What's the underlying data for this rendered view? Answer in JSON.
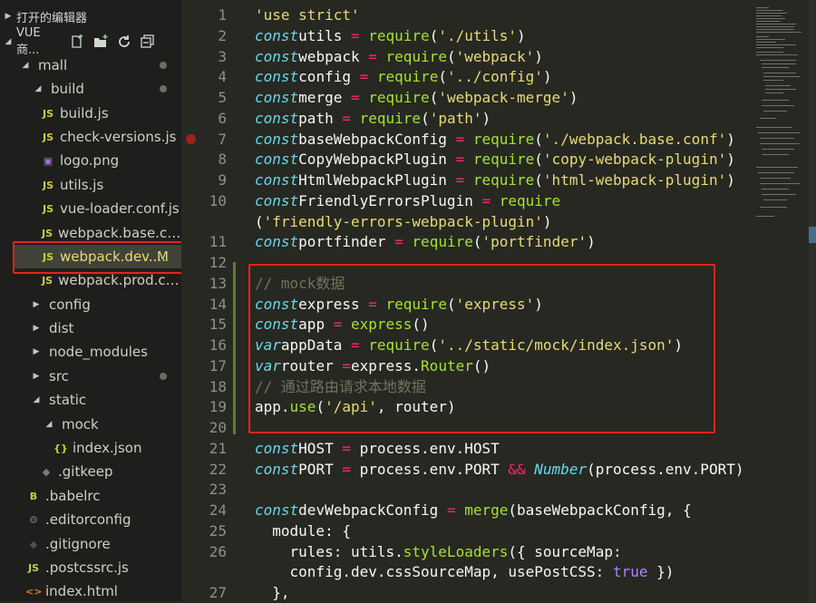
{
  "explorer": {
    "open_editors": "打开的编辑器",
    "workspace": "VUE商...",
    "tree": [
      {
        "label": "mall",
        "kind": "folder-open",
        "dot": true
      },
      {
        "label": "build",
        "kind": "folder-open",
        "dot": true
      },
      {
        "label": "build.js",
        "kind": "js"
      },
      {
        "label": "check-versions.js",
        "kind": "js"
      },
      {
        "label": "logo.png",
        "kind": "img"
      },
      {
        "label": "utils.js",
        "kind": "js"
      },
      {
        "label": "vue-loader.conf.js",
        "kind": "js"
      },
      {
        "label": "webpack.base.con...",
        "kind": "js"
      },
      {
        "label": "webpack.dev....",
        "kind": "js",
        "status": "M",
        "selected": true
      },
      {
        "label": "webpack.prod.con...",
        "kind": "js"
      },
      {
        "label": "config",
        "kind": "folder"
      },
      {
        "label": "dist",
        "kind": "folder"
      },
      {
        "label": "node_modules",
        "kind": "folder"
      },
      {
        "label": "src",
        "kind": "folder",
        "dot": true
      },
      {
        "label": "static",
        "kind": "folder-open"
      },
      {
        "label": "mock",
        "kind": "folder-open"
      },
      {
        "label": "index.json",
        "kind": "json"
      },
      {
        "label": ".gitkeep",
        "kind": "gitkeep"
      },
      {
        "label": ".babelrc",
        "kind": "babel"
      },
      {
        "label": ".editorconfig",
        "kind": "gear"
      },
      {
        "label": ".gitignore",
        "kind": "git"
      },
      {
        "label": ".postcssrc.js",
        "kind": "js"
      },
      {
        "label": "index.html",
        "kind": "html"
      }
    ]
  },
  "editor": {
    "line_numbers": [
      "1",
      "2",
      "3",
      "4",
      "5",
      "6",
      "7",
      "8",
      "9",
      "10",
      "",
      "11",
      "12",
      "13",
      "14",
      "15",
      "16",
      "17",
      "18",
      "19",
      "20",
      "21",
      "22",
      "23",
      "24",
      "25",
      "26",
      "",
      "27"
    ],
    "lines": [
      [
        [
          "str",
          "'use strict'"
        ]
      ],
      [
        [
          "kw",
          "const"
        ],
        [
          "",
          "utils "
        ],
        [
          "op",
          "="
        ],
        [
          "",
          " "
        ],
        [
          "fn",
          "require"
        ],
        [
          "",
          "("
        ],
        [
          "str",
          "'./utils'"
        ],
        [
          "",
          ")"
        ]
      ],
      [
        [
          "kw",
          "const"
        ],
        [
          "",
          "webpack "
        ],
        [
          "op",
          "="
        ],
        [
          "",
          " "
        ],
        [
          "fn",
          "require"
        ],
        [
          "",
          "("
        ],
        [
          "str",
          "'webpack'"
        ],
        [
          "",
          ")"
        ]
      ],
      [
        [
          "kw",
          "const"
        ],
        [
          "",
          "config "
        ],
        [
          "op",
          "="
        ],
        [
          "",
          " "
        ],
        [
          "fn",
          "require"
        ],
        [
          "",
          "("
        ],
        [
          "str",
          "'../config'"
        ],
        [
          "",
          ")"
        ]
      ],
      [
        [
          "kw",
          "const"
        ],
        [
          "",
          "merge "
        ],
        [
          "op",
          "="
        ],
        [
          "",
          " "
        ],
        [
          "fn",
          "require"
        ],
        [
          "",
          "("
        ],
        [
          "str",
          "'webpack-merge'"
        ],
        [
          "",
          ")"
        ]
      ],
      [
        [
          "kw",
          "const"
        ],
        [
          "",
          "path "
        ],
        [
          "op",
          "="
        ],
        [
          "",
          " "
        ],
        [
          "fn",
          "require"
        ],
        [
          "",
          "("
        ],
        [
          "str",
          "'path'"
        ],
        [
          "",
          ")"
        ]
      ],
      [
        [
          "kw",
          "const"
        ],
        [
          "",
          "baseWebpackConfig "
        ],
        [
          "op",
          "="
        ],
        [
          "",
          " "
        ],
        [
          "fn",
          "require"
        ],
        [
          "",
          "("
        ],
        [
          "str",
          "'./webpack.base.conf'"
        ],
        [
          "",
          ")"
        ]
      ],
      [
        [
          "kw",
          "const"
        ],
        [
          "",
          "CopyWebpackPlugin "
        ],
        [
          "op",
          "="
        ],
        [
          "",
          " "
        ],
        [
          "fn",
          "require"
        ],
        [
          "",
          "("
        ],
        [
          "str",
          "'copy-webpack-plugin'"
        ],
        [
          "",
          ")"
        ]
      ],
      [
        [
          "kw",
          "const"
        ],
        [
          "",
          "HtmlWebpackPlugin "
        ],
        [
          "op",
          "="
        ],
        [
          "",
          " "
        ],
        [
          "fn",
          "require"
        ],
        [
          "",
          "("
        ],
        [
          "str",
          "'html-webpack-plugin'"
        ],
        [
          "",
          ")"
        ]
      ],
      [
        [
          "kw",
          "const"
        ],
        [
          "",
          "FriendlyErrorsPlugin "
        ],
        [
          "op",
          "="
        ],
        [
          "",
          " "
        ],
        [
          "fn",
          "require"
        ]
      ],
      [
        [
          "",
          "("
        ],
        [
          "str",
          "'friendly-errors-webpack-plugin'"
        ],
        [
          "",
          ")"
        ]
      ],
      [
        [
          "kw",
          "const"
        ],
        [
          "",
          "portfinder "
        ],
        [
          "op",
          "="
        ],
        [
          "",
          " "
        ],
        [
          "fn",
          "require"
        ],
        [
          "",
          "("
        ],
        [
          "str",
          "'portfinder'"
        ],
        [
          "",
          ")"
        ]
      ],
      [
        [
          "",
          ""
        ]
      ],
      [
        [
          "cm",
          "// mock数据"
        ]
      ],
      [
        [
          "kw",
          "const"
        ],
        [
          "",
          "express "
        ],
        [
          "op",
          "="
        ],
        [
          "",
          " "
        ],
        [
          "fn",
          "require"
        ],
        [
          "",
          "("
        ],
        [
          "str",
          "'express'"
        ],
        [
          "",
          ")"
        ]
      ],
      [
        [
          "kw",
          "const"
        ],
        [
          "",
          "app "
        ],
        [
          "op",
          "="
        ],
        [
          "",
          " "
        ],
        [
          "fn",
          "express"
        ],
        [
          "",
          "()"
        ]
      ],
      [
        [
          "kw",
          "var"
        ],
        [
          "",
          "appData "
        ],
        [
          "op",
          "="
        ],
        [
          "",
          " "
        ],
        [
          "fn",
          "require"
        ],
        [
          "",
          "("
        ],
        [
          "str",
          "'../static/mock/index.json'"
        ],
        [
          "",
          ")"
        ]
      ],
      [
        [
          "kw",
          "var"
        ],
        [
          "",
          "router "
        ],
        [
          "op",
          "="
        ],
        [
          "",
          "express."
        ],
        [
          "fn",
          "Router"
        ],
        [
          "",
          "()"
        ]
      ],
      [
        [
          "cm",
          "// 通过路由请求本地数据"
        ]
      ],
      [
        [
          "",
          "app."
        ],
        [
          "fn",
          "use"
        ],
        [
          "",
          "("
        ],
        [
          "str",
          "'/api'"
        ],
        [
          "",
          ", router)"
        ]
      ],
      [
        [
          "",
          ""
        ]
      ],
      [
        [
          "kw",
          "const"
        ],
        [
          "",
          "HOST "
        ],
        [
          "op",
          "="
        ],
        [
          "",
          " process.env.HOST"
        ]
      ],
      [
        [
          "kw",
          "const"
        ],
        [
          "",
          "PORT "
        ],
        [
          "op",
          "="
        ],
        [
          "",
          " process.env.PORT "
        ],
        [
          "op",
          "&&"
        ],
        [
          "",
          " "
        ],
        [
          "tp",
          "Number"
        ],
        [
          "",
          "(process.env.PORT)"
        ]
      ],
      [
        [
          "",
          ""
        ]
      ],
      [
        [
          "kw",
          "const"
        ],
        [
          "",
          "devWebpackConfig "
        ],
        [
          "op",
          "="
        ],
        [
          "",
          " "
        ],
        [
          "fn",
          "merge"
        ],
        [
          "",
          "(baseWebpackConfig, {"
        ]
      ],
      [
        [
          "",
          "  module: {"
        ]
      ],
      [
        [
          "",
          "    rules: utils."
        ],
        [
          "fn",
          "styleLoaders"
        ],
        [
          "",
          "({ sourceMap:"
        ]
      ],
      [
        [
          "",
          "    config.dev.cssSourceMap, usePostCSS: "
        ],
        [
          "bool",
          "true"
        ],
        [
          "",
          " })"
        ]
      ],
      [
        [
          "",
          "  },"
        ]
      ]
    ]
  },
  "colors": {
    "background": "#272822",
    "sidebar": "#1e1f1c",
    "highlight": "#e8221b",
    "modified": "#e6db74"
  }
}
